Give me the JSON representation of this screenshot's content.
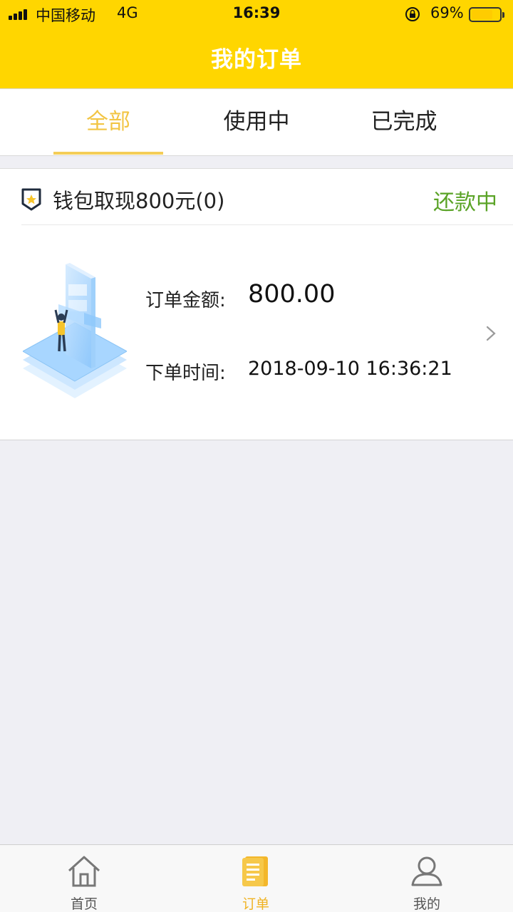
{
  "status_bar": {
    "carrier": "中国移动",
    "network": "4G",
    "time": "16:39",
    "battery_percent": "69%",
    "battery_level": 0.69
  },
  "header": {
    "title": "我的订单",
    "color": "#ffd600"
  },
  "tabs": [
    {
      "label": "全部",
      "active": true
    },
    {
      "label": "使用中",
      "active": false
    },
    {
      "label": "已完成",
      "active": false
    }
  ],
  "order": {
    "name": "钱包取现800元(0)",
    "status": "还款中",
    "status_color": "#5aa326",
    "amount_label": "订单金额:",
    "amount_value": "800.00",
    "time_label": "下单时间:",
    "time_value": "2018-09-10 16:36:21",
    "icons": [
      "shield-badge-icon",
      "phone-illustration",
      "chevron-right-icon"
    ]
  },
  "bottom_nav": [
    {
      "label": "首页",
      "icon": "home-icon",
      "active": false
    },
    {
      "label": "订单",
      "icon": "order-book-icon",
      "active": true
    },
    {
      "label": "我的",
      "icon": "user-icon",
      "active": false
    }
  ],
  "accent_color": "#f2c544"
}
